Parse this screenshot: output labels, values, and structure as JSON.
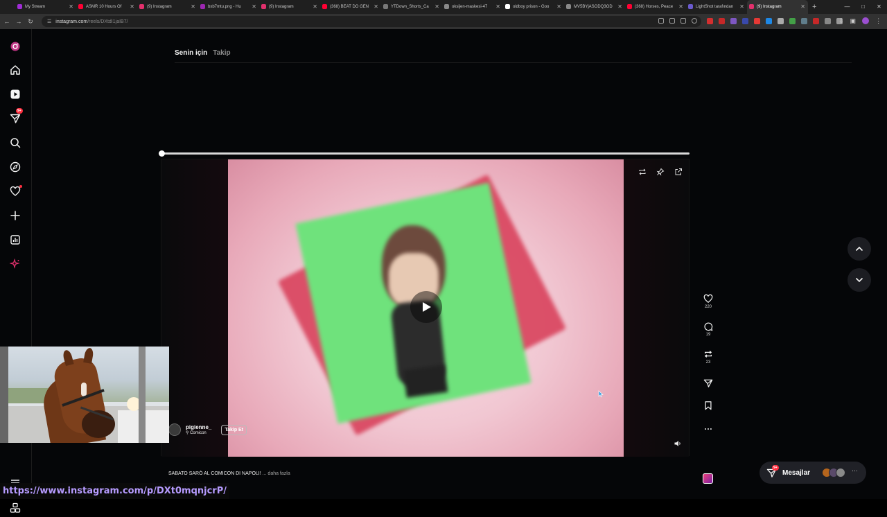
{
  "browser": {
    "tabs": [
      {
        "title": "My Stream",
        "color": "#a02cd6"
      },
      {
        "title": "ASMR 10 Hours Of",
        "color": "#ff0033"
      },
      {
        "title": "(9) Instagram",
        "color": "#e1306c"
      },
      {
        "title": "bxb7mtu.png - Hu",
        "color": "#9c27b0"
      },
      {
        "title": "(9) Instagram",
        "color": "#e1306c"
      },
      {
        "title": "(368) BEAT DO GEN",
        "color": "#ff0033"
      },
      {
        "title": "YTDown_Shorts_Ca",
        "color": "#777777"
      },
      {
        "title": "oksijen-maskesi-47",
        "color": "#888888"
      },
      {
        "title": "oldboy prison - Goo",
        "color": "#ffffff"
      },
      {
        "title": "MV5BYjASODQ3OD",
        "color": "#888888"
      },
      {
        "title": "(368) Horses, Peace",
        "color": "#ff0033"
      },
      {
        "title": "LightShot tarafından",
        "color": "#6a5acd"
      },
      {
        "title": "(9) Instagram",
        "color": "#e1306c",
        "active": true
      }
    ],
    "new_tab": "+",
    "url_host": "instagram.com",
    "url_path": "/reels/DXtdI1jaIB7/",
    "status_url": "https://www.instagram.com/p/DXt0mqnjcrP/"
  },
  "sidebar": {
    "notif_badge": "9+",
    "items": [
      "instagram-logo",
      "home",
      "reels",
      "messages",
      "search",
      "explore",
      "notifications",
      "create",
      "dashboard",
      "meta-ai"
    ]
  },
  "feed": {
    "tab_active": "Senin için",
    "tab_inactive": "Takip",
    "progress": 0.0
  },
  "reel": {
    "author": "pigienne_",
    "location": "Comicon",
    "follow_label": "Takip Et",
    "caption": "SABATO SARÒ AL COMICON DI NAPOLI!",
    "caption_more": "... daha fazla",
    "likes": "220",
    "comments": "19",
    "reposts": "23"
  },
  "messages": {
    "label": "Mesajlar",
    "badge": "9+",
    "more": "···"
  }
}
